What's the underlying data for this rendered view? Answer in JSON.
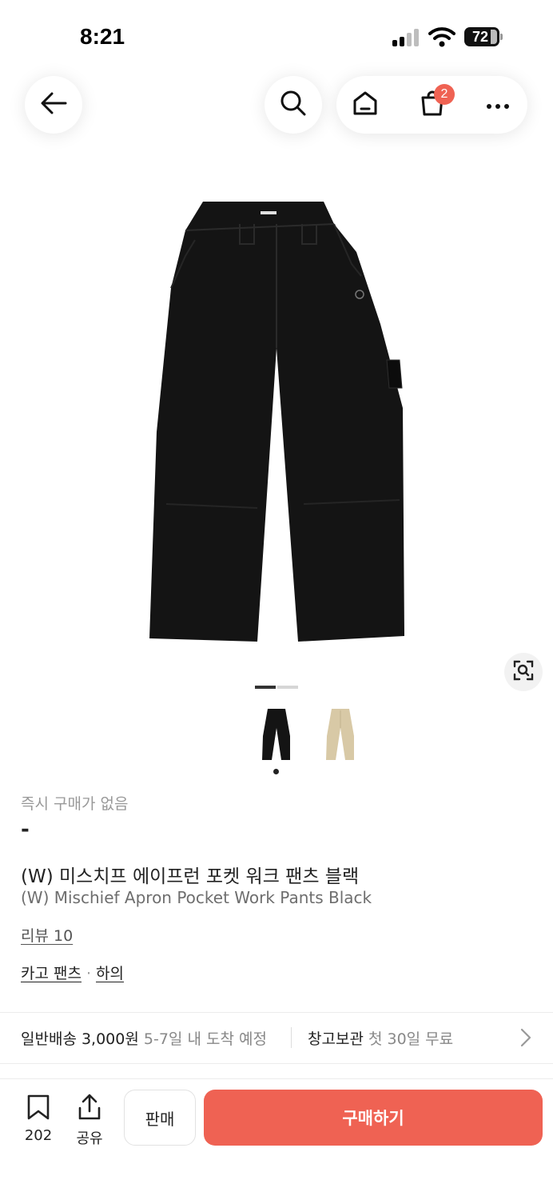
{
  "status_bar": {
    "time": "8:21",
    "battery": "72"
  },
  "nav": {
    "cart_count": "2"
  },
  "product": {
    "no_immediate_buy": "즉시 구매가 없음",
    "price": "-",
    "title_ko": "(W) 미스치프 에이프런 포켓 워크 팬츠 블랙",
    "title_en": "(W) Mischief Apron Pocket Work Pants Black",
    "review": "리뷰 10",
    "category_1": "카고 팬츠",
    "category_sep": "·",
    "category_2": "하의"
  },
  "shipping": {
    "label": "일반배송",
    "fee": "3,000원",
    "eta": "5-7일 내 도착 예정",
    "storage_label": "창고보관",
    "storage_note": "첫 30일 무료"
  },
  "bottom_bar": {
    "bookmark_count": "202",
    "share_label": "공유",
    "sell_label": "판매",
    "buy_label": "구매하기"
  },
  "colors": {
    "accent": "#ef6253",
    "product_black": "#141414",
    "product_beige": "#d8c9a6"
  },
  "icons": [
    "back-arrow-icon",
    "search-icon",
    "home-icon",
    "cart-icon",
    "more-icon",
    "lens-icon",
    "bookmark-icon",
    "share-icon",
    "chevron-right-icon"
  ]
}
